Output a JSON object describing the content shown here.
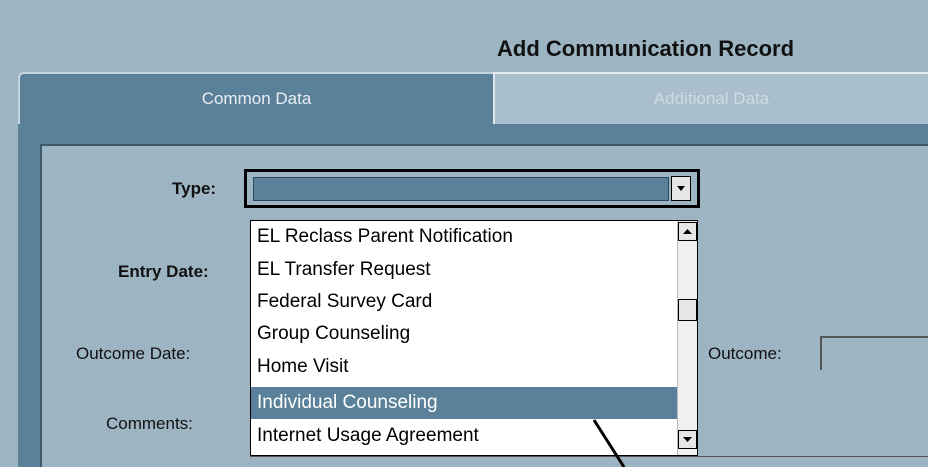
{
  "header": {
    "title": "Add Communication Record"
  },
  "tabs": [
    {
      "label": "Common Data",
      "active": true
    },
    {
      "label": "Additional Data",
      "active": false
    }
  ],
  "form": {
    "type_label": "Type:",
    "entry_date_label": "Entry Date:",
    "outcome_date_label": "Outcome Date:",
    "comments_label": "Comments:",
    "outcome_label": "Outcome:",
    "type_value": ""
  },
  "dropdown": {
    "options": [
      "EL Reclass Parent Notification",
      "EL Transfer Request",
      "Federal Survey Card",
      "Group Counseling",
      "Home Visit",
      "Individual Counseling",
      "Internet Usage Agreement"
    ],
    "selected_index": 5
  },
  "icons": {
    "dropdown_arrow": "chevron-down-icon",
    "scroll_up": "scroll-up-arrow-icon",
    "scroll_down": "scroll-down-arrow-icon"
  },
  "colors": {
    "accent": "#5a8199",
    "background": "#9db5c3"
  }
}
